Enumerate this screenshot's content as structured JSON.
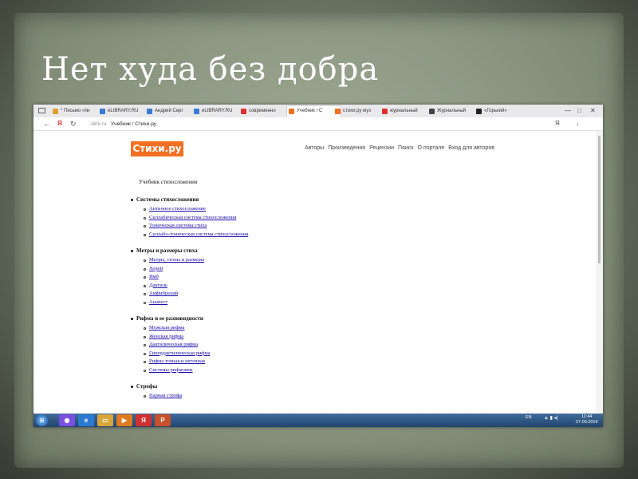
{
  "slide": {
    "title": "Нет худа без добра"
  },
  "browser": {
    "tabs": [
      {
        "label": "* Письмо «№",
        "color": "#e0a030"
      },
      {
        "label": "eLIBRARY.RU",
        "color": "#3a7bd5"
      },
      {
        "label": "Андрей Серг",
        "color": "#3a7bd5"
      },
      {
        "label": "eLIBRARY.RU",
        "color": "#3a7bd5"
      },
      {
        "label": "современно",
        "color": "#e03030"
      },
      {
        "label": "Учебник / С",
        "color": "#f36f21",
        "active": true
      },
      {
        "label": "стихи.ру муз",
        "color": "#f36f21"
      },
      {
        "label": "журнальный",
        "color": "#e03030"
      },
      {
        "label": "Журнальный",
        "color": "#444444"
      },
      {
        "label": "«Горький»",
        "color": "#222222"
      }
    ],
    "nav": {
      "back": "←",
      "yandex": "Я",
      "reload": "↻"
    },
    "address": {
      "host": "stihi.ru",
      "title": "Учебник / Стихи.ру"
    },
    "window": {
      "minimize": "—",
      "maximize": "□",
      "close": "✕"
    },
    "right_icons": {
      "yandex": "Я",
      "download": "↓"
    }
  },
  "site": {
    "logo": "Стихи.ру",
    "nav": [
      "Авторы",
      "Произведения",
      "Рецензии",
      "Поиск",
      "О портале",
      "Вход для авторов"
    ],
    "heading": "Учебник стихосложения",
    "sections": [
      {
        "title": "Системы стихосложения",
        "items": [
          "Античное стихосложение",
          "Силлабическая система стихосложения",
          "Тоническая система стиха",
          "Силлабо-тоническая система стихосложения"
        ]
      },
      {
        "title": "Метры и размеры стиха",
        "items": [
          "Метры, стопы и размеры",
          "Хорей",
          "Ямб",
          "Дактиль",
          "Амфибрахий",
          "Анапест"
        ]
      },
      {
        "title": "Рифма и ее разновидности",
        "items": [
          "Мужская рифма",
          "Женская рифма",
          "Дактилическая рифма",
          "Гипердактилическая рифма",
          "Рифма точная и неточная",
          "Системы рифмовки"
        ]
      },
      {
        "title": "Строфы",
        "items": [
          "Парная строфа"
        ]
      }
    ]
  },
  "taskbar": {
    "apps": [
      {
        "name": "alice",
        "glyph": "◉",
        "color": "#7a4fe0"
      },
      {
        "name": "ie",
        "glyph": "e",
        "color": "#2a7ad0"
      },
      {
        "name": "folder",
        "glyph": "▭",
        "color": "#d9a63a"
      },
      {
        "name": "media",
        "glyph": "▶",
        "color": "#e07a20"
      },
      {
        "name": "yandex",
        "glyph": "Я",
        "color": "#d03030"
      },
      {
        "name": "powerpoint",
        "glyph": "P",
        "color": "#c8502a"
      }
    ],
    "lang": "EN",
    "time": "11:44",
    "date": "27.09.2019"
  }
}
